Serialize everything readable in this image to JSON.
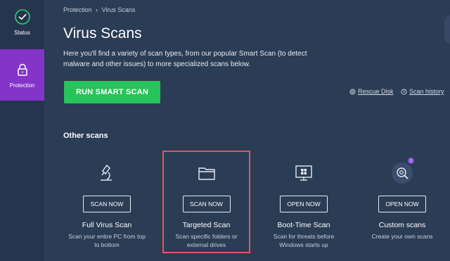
{
  "sidebar": {
    "items": [
      {
        "label": "Status",
        "icon": "check-circle-icon"
      },
      {
        "label": "Protection",
        "icon": "lock-icon"
      }
    ]
  },
  "breadcrumb": {
    "parent": "Protection",
    "separator": "›",
    "current": "Virus Scans"
  },
  "header": {
    "title": "Virus Scans",
    "intro": "Here you'll find a variety of scan types, from our popular Smart Scan (to detect malware and other issues) to more specialized scans below."
  },
  "actions": {
    "run_label": "RUN SMART SCAN",
    "rescue_disk": "Rescue Disk",
    "scan_history": "Scan history"
  },
  "other_scans": {
    "heading": "Other scans",
    "cards": [
      {
        "icon": "microscope-icon",
        "button": "SCAN NOW",
        "title": "Full Virus Scan",
        "desc": "Scan your entire PC from top to bottom"
      },
      {
        "icon": "folder-icon",
        "button": "SCAN NOW",
        "title": "Targeted Scan",
        "desc": "Scan specific folders or external drives"
      },
      {
        "icon": "monitor-windows-icon",
        "button": "OPEN NOW",
        "title": "Boot-Time Scan",
        "desc": "Scan for threats before Windows starts up"
      },
      {
        "icon": "gear-search-icon",
        "button": "OPEN NOW",
        "title": "Custom scans",
        "desc": "Create your own scans",
        "badge": "1"
      }
    ]
  },
  "colors": {
    "background": "#2b3c55",
    "sidebar": "#253550",
    "active_nav": "#8434c9",
    "primary_button": "#26c45a",
    "highlight_border": "#e2565f"
  }
}
